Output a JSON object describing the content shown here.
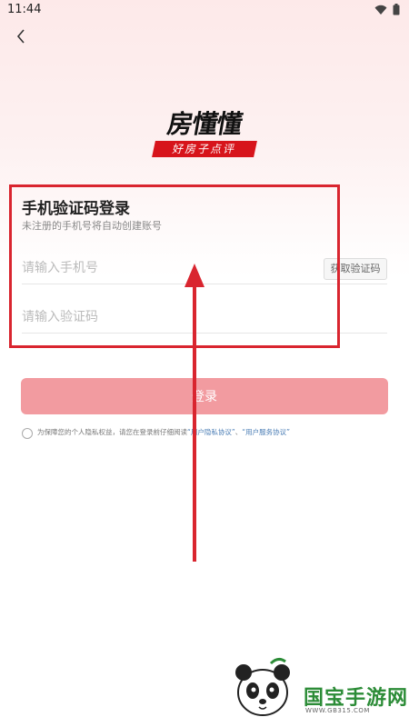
{
  "status_bar": {
    "time": "11:44",
    "wifi_icon": "wifi-icon",
    "battery_icon": "battery-icon"
  },
  "header": {
    "back_icon": "chevron-left-icon"
  },
  "logo": {
    "main": "房懂懂",
    "sub": "好房子点评"
  },
  "form": {
    "title": "手机验证码登录",
    "subtitle": "未注册的手机号将自动创建账号",
    "phone_placeholder": "请输入手机号",
    "get_code_label": "获取验证码",
    "code_placeholder": "请输入验证码",
    "login_label": "登录"
  },
  "agreement": {
    "text_prefix": "为保障您的个人隐私权益，请您在登录前仔细阅读",
    "privacy_link": "“用户隐私协议”",
    "separator": "、",
    "service_link": "“用户服务协议”"
  },
  "watermark": {
    "title": "国宝手游网",
    "url": "WWW.GB315.COM"
  },
  "colors": {
    "accent": "#d9252f",
    "login_button": "#f29ba0",
    "link": "#4a7db5"
  }
}
